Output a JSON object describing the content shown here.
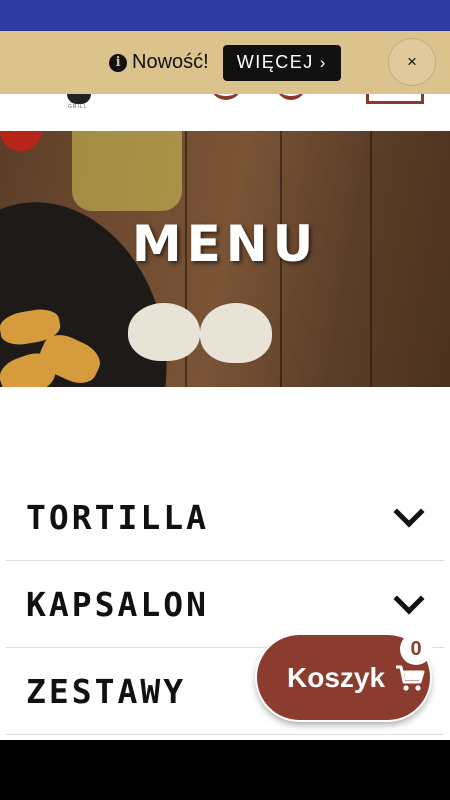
{
  "announcement": {
    "text": "Nowość!",
    "button_label": "WIĘCEJ",
    "close_label": "×"
  },
  "header": {
    "logo_text": "GRILL"
  },
  "hero": {
    "title": "MENU"
  },
  "categories": [
    {
      "label": "TORTILLA"
    },
    {
      "label": "KAPSALON"
    },
    {
      "label": "ZESTAWY"
    }
  ],
  "cart": {
    "label": "Koszyk",
    "count": "0"
  },
  "colors": {
    "status_bar": "#2e3a9f",
    "announcement_bg": "#dcc38e",
    "brand": "#8c3b2f"
  }
}
